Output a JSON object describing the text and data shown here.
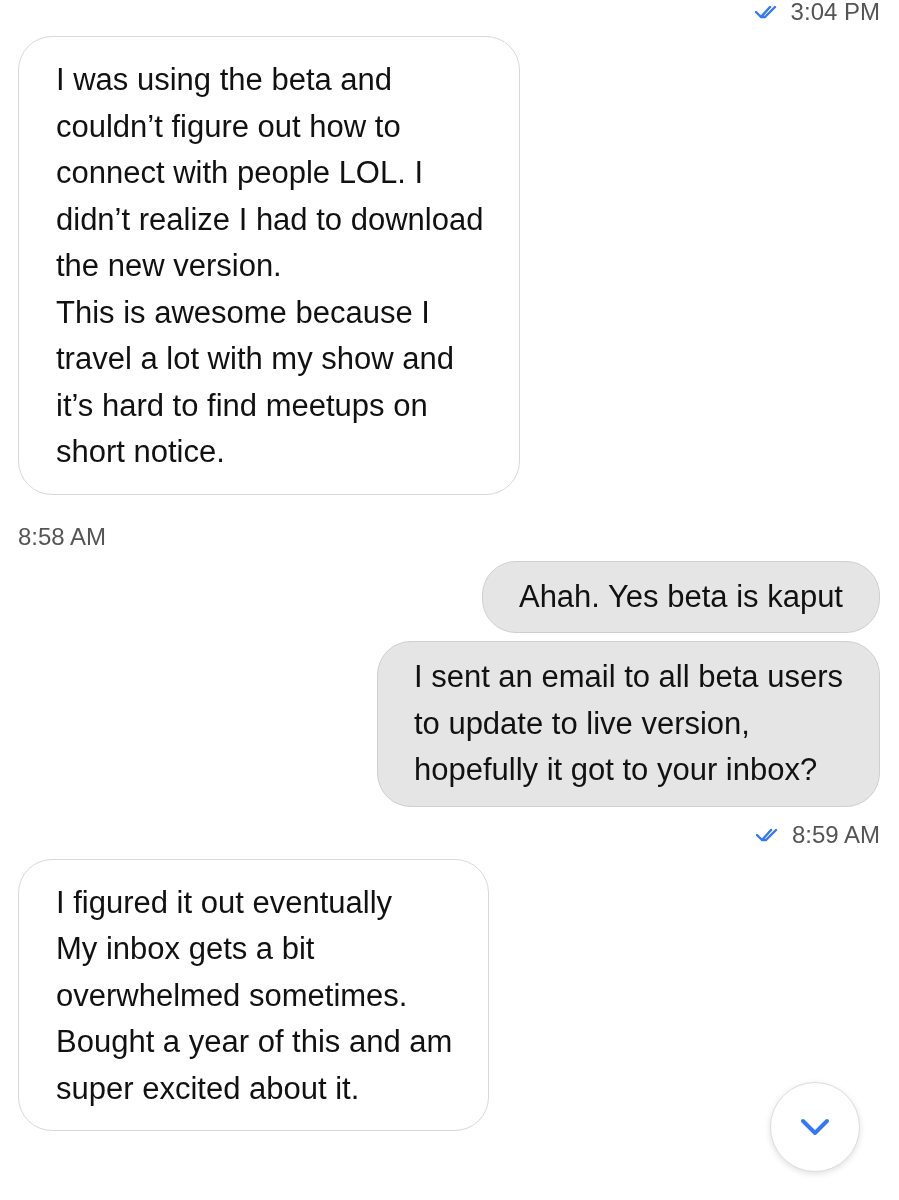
{
  "conversation": [
    {
      "kind": "timestamp",
      "outgoing": true,
      "read": true,
      "time": "3:04 PM"
    },
    {
      "kind": "message",
      "outgoing": false,
      "text": "I was using the beta and\ncouldn’t figure out how to\nconnect with people LOL. I\ndidn’t realize I had to download\nthe new version.\nThis is awesome because I\ntravel a lot with my show and\nit’s hard to find meetups on\nshort notice."
    },
    {
      "kind": "timestamp",
      "outgoing": false,
      "read": false,
      "time": "8:58 AM"
    },
    {
      "kind": "message",
      "outgoing": true,
      "text": "Ahah. Yes beta is kaput"
    },
    {
      "kind": "message",
      "outgoing": true,
      "text": "I sent an email to all beta users\nto update to live version,\nhopefully it got to your inbox?"
    },
    {
      "kind": "timestamp",
      "outgoing": true,
      "read": true,
      "time": "8:59 AM"
    },
    {
      "kind": "message",
      "outgoing": false,
      "text": "I figured it out eventually\nMy inbox gets a bit\noverwhelmed sometimes.\nBought a year of this and am\nsuper excited about it."
    }
  ]
}
